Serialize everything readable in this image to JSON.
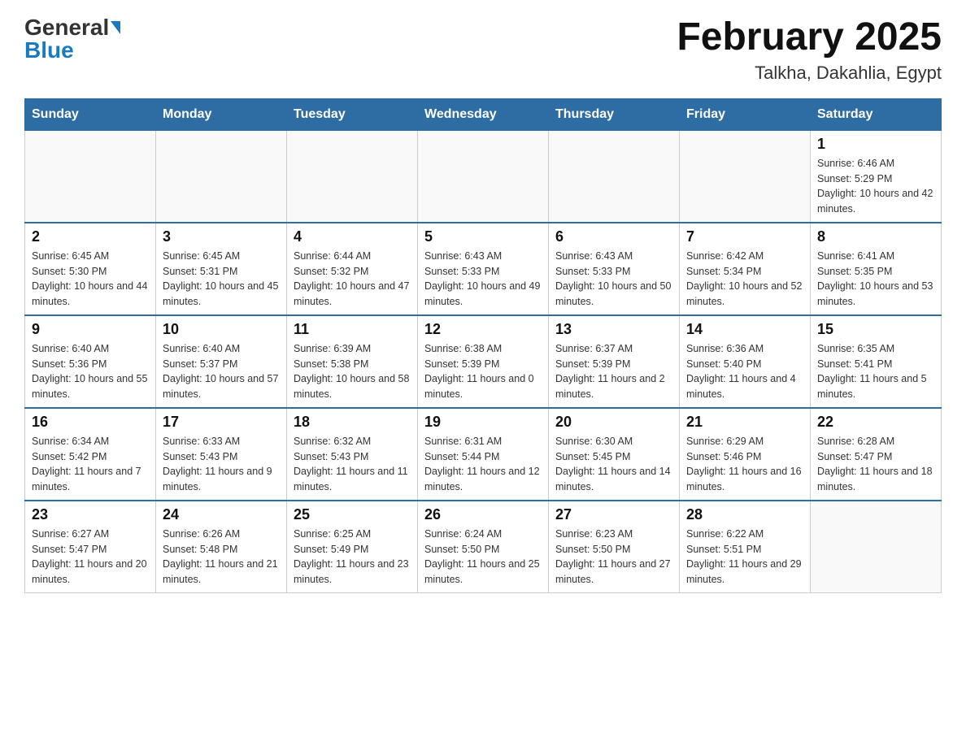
{
  "header": {
    "logo_general": "General",
    "logo_blue": "Blue",
    "title": "February 2025",
    "subtitle": "Talkha, Dakahlia, Egypt"
  },
  "weekdays": [
    "Sunday",
    "Monday",
    "Tuesday",
    "Wednesday",
    "Thursday",
    "Friday",
    "Saturday"
  ],
  "weeks": [
    [
      {
        "day": "",
        "sunrise": "",
        "sunset": "",
        "daylight": ""
      },
      {
        "day": "",
        "sunrise": "",
        "sunset": "",
        "daylight": ""
      },
      {
        "day": "",
        "sunrise": "",
        "sunset": "",
        "daylight": ""
      },
      {
        "day": "",
        "sunrise": "",
        "sunset": "",
        "daylight": ""
      },
      {
        "day": "",
        "sunrise": "",
        "sunset": "",
        "daylight": ""
      },
      {
        "day": "",
        "sunrise": "",
        "sunset": "",
        "daylight": ""
      },
      {
        "day": "1",
        "sunrise": "Sunrise: 6:46 AM",
        "sunset": "Sunset: 5:29 PM",
        "daylight": "Daylight: 10 hours and 42 minutes."
      }
    ],
    [
      {
        "day": "2",
        "sunrise": "Sunrise: 6:45 AM",
        "sunset": "Sunset: 5:30 PM",
        "daylight": "Daylight: 10 hours and 44 minutes."
      },
      {
        "day": "3",
        "sunrise": "Sunrise: 6:45 AM",
        "sunset": "Sunset: 5:31 PM",
        "daylight": "Daylight: 10 hours and 45 minutes."
      },
      {
        "day": "4",
        "sunrise": "Sunrise: 6:44 AM",
        "sunset": "Sunset: 5:32 PM",
        "daylight": "Daylight: 10 hours and 47 minutes."
      },
      {
        "day": "5",
        "sunrise": "Sunrise: 6:43 AM",
        "sunset": "Sunset: 5:33 PM",
        "daylight": "Daylight: 10 hours and 49 minutes."
      },
      {
        "day": "6",
        "sunrise": "Sunrise: 6:43 AM",
        "sunset": "Sunset: 5:33 PM",
        "daylight": "Daylight: 10 hours and 50 minutes."
      },
      {
        "day": "7",
        "sunrise": "Sunrise: 6:42 AM",
        "sunset": "Sunset: 5:34 PM",
        "daylight": "Daylight: 10 hours and 52 minutes."
      },
      {
        "day": "8",
        "sunrise": "Sunrise: 6:41 AM",
        "sunset": "Sunset: 5:35 PM",
        "daylight": "Daylight: 10 hours and 53 minutes."
      }
    ],
    [
      {
        "day": "9",
        "sunrise": "Sunrise: 6:40 AM",
        "sunset": "Sunset: 5:36 PM",
        "daylight": "Daylight: 10 hours and 55 minutes."
      },
      {
        "day": "10",
        "sunrise": "Sunrise: 6:40 AM",
        "sunset": "Sunset: 5:37 PM",
        "daylight": "Daylight: 10 hours and 57 minutes."
      },
      {
        "day": "11",
        "sunrise": "Sunrise: 6:39 AM",
        "sunset": "Sunset: 5:38 PM",
        "daylight": "Daylight: 10 hours and 58 minutes."
      },
      {
        "day": "12",
        "sunrise": "Sunrise: 6:38 AM",
        "sunset": "Sunset: 5:39 PM",
        "daylight": "Daylight: 11 hours and 0 minutes."
      },
      {
        "day": "13",
        "sunrise": "Sunrise: 6:37 AM",
        "sunset": "Sunset: 5:39 PM",
        "daylight": "Daylight: 11 hours and 2 minutes."
      },
      {
        "day": "14",
        "sunrise": "Sunrise: 6:36 AM",
        "sunset": "Sunset: 5:40 PM",
        "daylight": "Daylight: 11 hours and 4 minutes."
      },
      {
        "day": "15",
        "sunrise": "Sunrise: 6:35 AM",
        "sunset": "Sunset: 5:41 PM",
        "daylight": "Daylight: 11 hours and 5 minutes."
      }
    ],
    [
      {
        "day": "16",
        "sunrise": "Sunrise: 6:34 AM",
        "sunset": "Sunset: 5:42 PM",
        "daylight": "Daylight: 11 hours and 7 minutes."
      },
      {
        "day": "17",
        "sunrise": "Sunrise: 6:33 AM",
        "sunset": "Sunset: 5:43 PM",
        "daylight": "Daylight: 11 hours and 9 minutes."
      },
      {
        "day": "18",
        "sunrise": "Sunrise: 6:32 AM",
        "sunset": "Sunset: 5:43 PM",
        "daylight": "Daylight: 11 hours and 11 minutes."
      },
      {
        "day": "19",
        "sunrise": "Sunrise: 6:31 AM",
        "sunset": "Sunset: 5:44 PM",
        "daylight": "Daylight: 11 hours and 12 minutes."
      },
      {
        "day": "20",
        "sunrise": "Sunrise: 6:30 AM",
        "sunset": "Sunset: 5:45 PM",
        "daylight": "Daylight: 11 hours and 14 minutes."
      },
      {
        "day": "21",
        "sunrise": "Sunrise: 6:29 AM",
        "sunset": "Sunset: 5:46 PM",
        "daylight": "Daylight: 11 hours and 16 minutes."
      },
      {
        "day": "22",
        "sunrise": "Sunrise: 6:28 AM",
        "sunset": "Sunset: 5:47 PM",
        "daylight": "Daylight: 11 hours and 18 minutes."
      }
    ],
    [
      {
        "day": "23",
        "sunrise": "Sunrise: 6:27 AM",
        "sunset": "Sunset: 5:47 PM",
        "daylight": "Daylight: 11 hours and 20 minutes."
      },
      {
        "day": "24",
        "sunrise": "Sunrise: 6:26 AM",
        "sunset": "Sunset: 5:48 PM",
        "daylight": "Daylight: 11 hours and 21 minutes."
      },
      {
        "day": "25",
        "sunrise": "Sunrise: 6:25 AM",
        "sunset": "Sunset: 5:49 PM",
        "daylight": "Daylight: 11 hours and 23 minutes."
      },
      {
        "day": "26",
        "sunrise": "Sunrise: 6:24 AM",
        "sunset": "Sunset: 5:50 PM",
        "daylight": "Daylight: 11 hours and 25 minutes."
      },
      {
        "day": "27",
        "sunrise": "Sunrise: 6:23 AM",
        "sunset": "Sunset: 5:50 PM",
        "daylight": "Daylight: 11 hours and 27 minutes."
      },
      {
        "day": "28",
        "sunrise": "Sunrise: 6:22 AM",
        "sunset": "Sunset: 5:51 PM",
        "daylight": "Daylight: 11 hours and 29 minutes."
      },
      {
        "day": "",
        "sunrise": "",
        "sunset": "",
        "daylight": ""
      }
    ]
  ]
}
